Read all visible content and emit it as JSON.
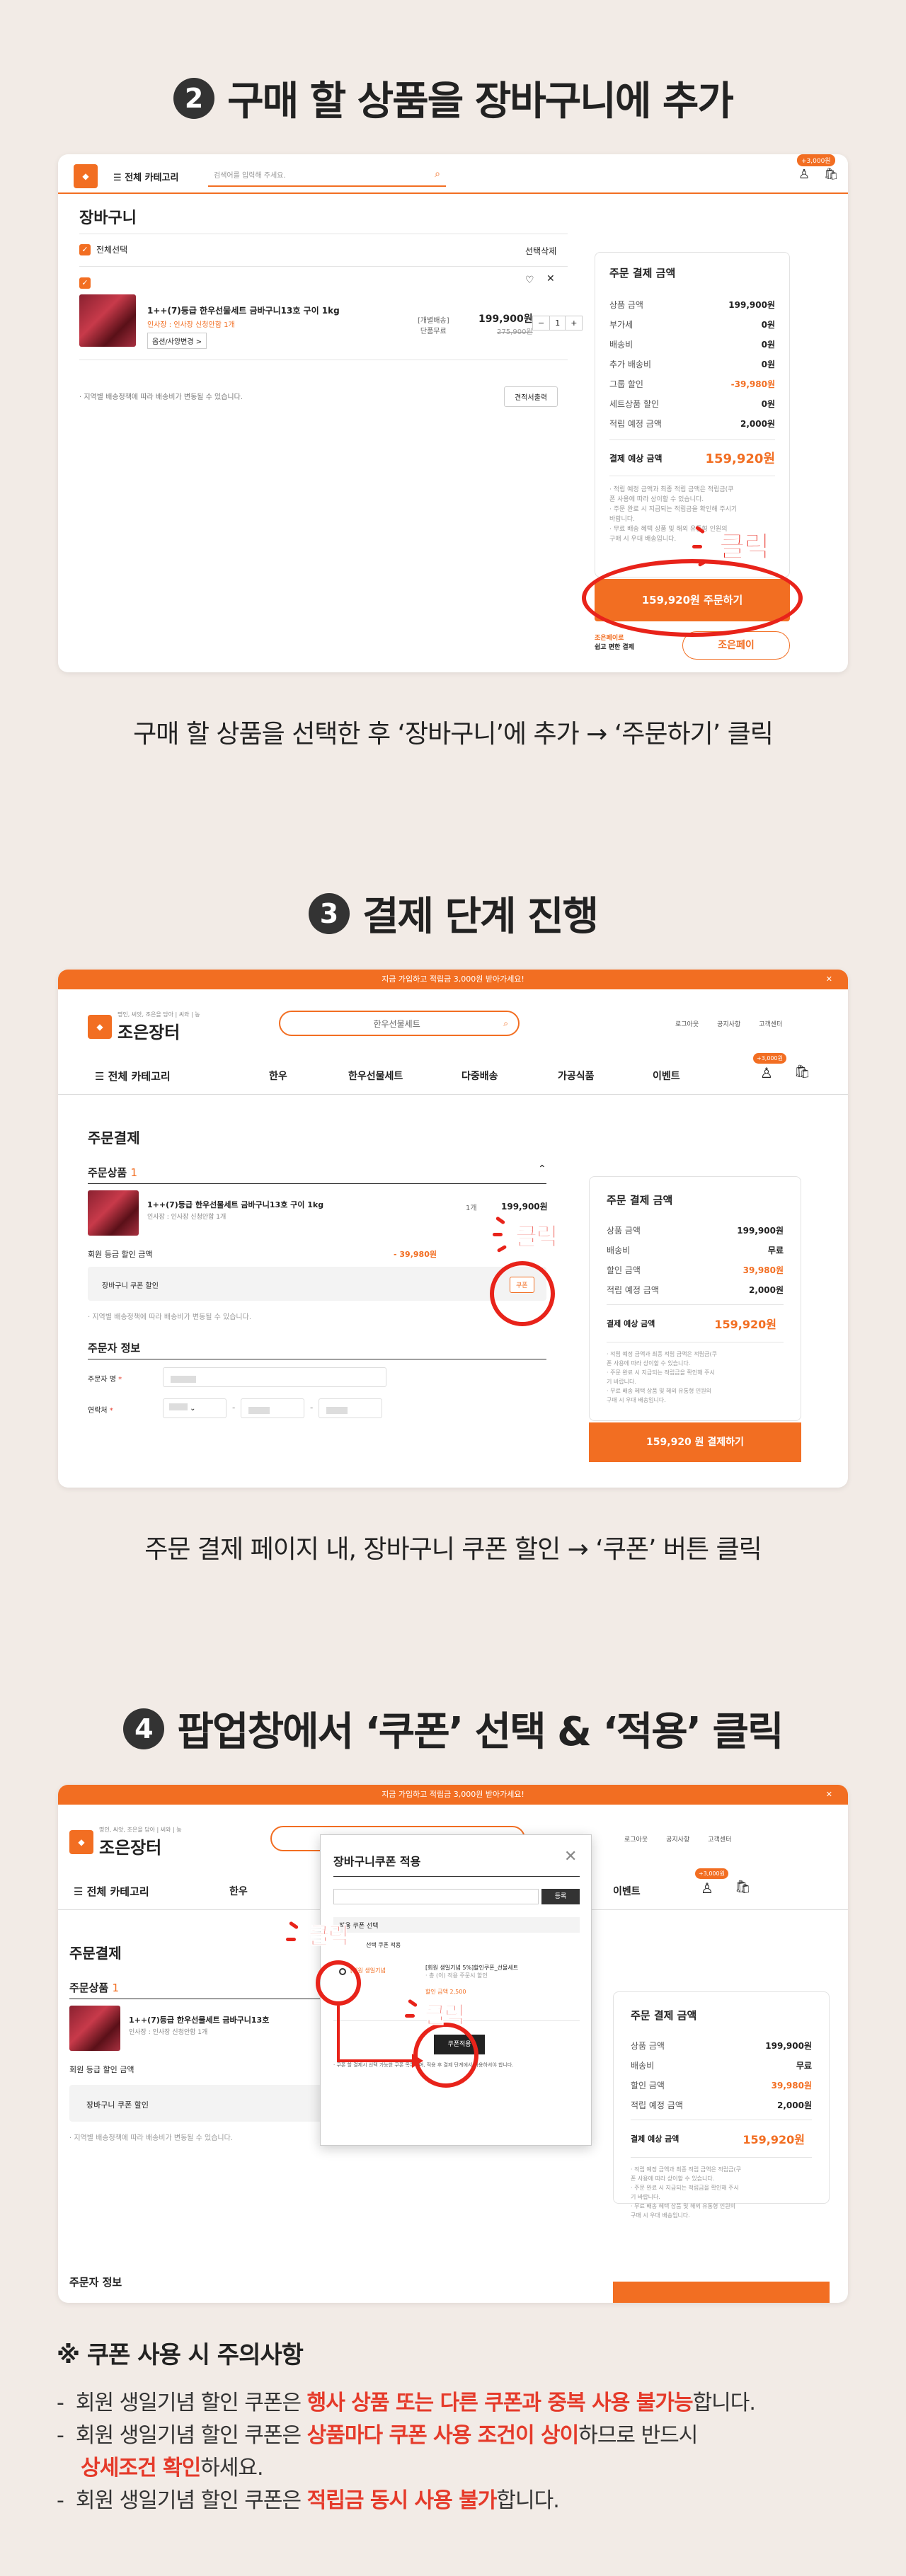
{
  "step2": {
    "num": "2",
    "title": "구매 할 상품을 장바구니에 추가",
    "caption": "구매 할 상품을 선택한 후 ‘장바구니’에 추가 → ‘주문하기’ 클릭"
  },
  "step3": {
    "num": "3",
    "title": "결제 단계 진행",
    "caption": "주문 결제 페이지 내, 장바구니 쿠폰 할인 → ‘쿠폰’ 버튼 클릭"
  },
  "step4": {
    "num": "4",
    "title": "팝업창에서 ‘쿠폰’ 선택 & ‘적용’ 클릭"
  },
  "click_label": "클릭",
  "s1": {
    "category": "전체 카테고리",
    "search_placeholder": "검색어를 입력해 주세요.",
    "badge": "+3,000원",
    "cart_title": "장바구니",
    "select_all": "전체선택",
    "delete_selected": "선택삭제",
    "product_name": "1++(7)등급 한우선물세트 금바구니13호 구이 1kg",
    "product_sub": "인사장 : 인사장 신청안함 1개",
    "option_btn": "옵션/사양변경 >",
    "ship_type": "[개별배송]",
    "ship_cost": "단품무료",
    "price": "199,900원",
    "orig_price": "275,900원",
    "qty": "1",
    "ship_note": "· 지역별 배송정책에 따라 배송비가 변동될 수 있습니다.",
    "estimate_btn": "견적서출력",
    "sum_title": "주문 결제 금액",
    "rows": [
      {
        "label": "상품 금액",
        "value": "199,900원"
      },
      {
        "label": "부가세",
        "value": "0원"
      },
      {
        "label": "배송비",
        "value": "0원"
      },
      {
        "label": "추가 배송비",
        "value": "0원"
      },
      {
        "label": "그룹 할인",
        "value": "-39,980원"
      },
      {
        "label": "세트상품 할인",
        "value": "0원"
      },
      {
        "label": "적립 예정 금액",
        "value": "2,000원"
      }
    ],
    "total_label": "결제 예상 금액",
    "total": "159,920원",
    "notes": [
      "· 적립 예정 금액과 최종 적립 금액은 적립금(쿠",
      "폰 사용에 따라 상이할 수 있습니다.",
      "· 주문 완료 시 지급되는 적립금을 확인해 주시기",
      "바랍니다.",
      "· 무료 배송 혜택 상품 및 해외 유통형 인원의",
      "구매 시 우대 배송입니다."
    ],
    "order_btn": "159,920원 주문하기",
    "pay_label1": "조은페이로",
    "pay_label2": "쉽고 편한 결제",
    "pay_btn": "조은페이"
  },
  "s2": {
    "topbar": "지금 가입하고 적립금 3,000원 받아가세요!",
    "logo_sub": "명인, 씨앗, 조은을 담아 | 씨와 | 농",
    "logo": "조은장터",
    "search": "한우선물세트",
    "links": [
      "로그아웃",
      "공지사항",
      "고객센터"
    ],
    "category": "전체 카테고리",
    "nav": [
      "한우",
      "한우선물세트",
      "다중배송",
      "가공식품",
      "이벤트"
    ],
    "badge": "+3,000원",
    "page_title": "주문결제",
    "items_label": "주문상품",
    "items_count": "1",
    "product_name": "1++(7)등급 한우선물세트 금바구니13호 구이 1kg",
    "product_sub": "인사장 : 인사장 신청안함 1개",
    "qty": "1개",
    "price": "199,900원",
    "grade_discount": "회원 등급 할인 금액",
    "grade_value": "- 39,980원",
    "coupon_label": "장바구니 쿠폰 할인",
    "coupon_btn": "쿠폰",
    "ship_note": "· 지역별 배송정책에 따라 배송비가 변동될 수 있습니다.",
    "orderer": "주문자 정보",
    "name_label": "주문자 명",
    "phone_label": "연락처",
    "sum_title": "주문 결제 금액",
    "rows": [
      {
        "label": "상품 금액",
        "value": "199,900원"
      },
      {
        "label": "배송비",
        "value": "무료"
      },
      {
        "label": "할인 금액",
        "value": "39,980원"
      },
      {
        "label": "적립 예정 금액",
        "value": "2,000원"
      }
    ],
    "total_label": "결제 예상 금액",
    "total": "159,920원",
    "notes": [
      "· 적립 예정 금액과 최종 적립 금액은 적립금(쿠",
      "폰 사용에 따라 상이할 수 있습니다.",
      "· 주문 완료 시 지급되는 적립금을 확인해 주시",
      "기 바랍니다.",
      "· 무료 배송 혜택 상품 및 해외 유통형 인원의",
      "구매 시 우대 배송입니다."
    ],
    "pay_btn": "159,920 원 결제하기"
  },
  "s3": {
    "popup_title": "장바구니쿠폰 적용",
    "popup_search_btn": "등록",
    "popup_section": "적용 쿠폰 선택",
    "popup_section2": "선택 쿠폰 적용",
    "coupon_name": "[회원 생일기념 5%]할인쿠폰_선물세트",
    "coupon_detail": "· 총 (이) 적용 주문시 할인",
    "coupon_value": "할인 금액 2,500",
    "apply_btn": "쿠폰적용",
    "popup_note": "· 쿠폰 할 결제시 선택 가능한 쿠폰 목록이며, 적용 후 결제 단계에서 사용하셔야 합니다."
  },
  "caution": {
    "title": "※ 쿠폰 사용 시 주의사항",
    "lines": [
      {
        "pre": "-  회원 생일기념 할인 쿠폰은 ",
        "hl": "행사 상품 또는 다른 쿠폰과 중복 사용 불가능",
        "post": "합니다."
      },
      {
        "pre": "-  회원 생일기념 할인 쿠폰은 ",
        "hl": "상품마다 쿠폰 사용 조건이 상이",
        "post": "하므로 반드시"
      },
      {
        "pre": "    ",
        "hl": "상세조건 확인",
        "post": "하세요."
      },
      {
        "pre": "-  회원 생일기념 할인 쿠폰은 ",
        "hl": "적립금 동시 사용 불가",
        "post": "합니다."
      }
    ]
  }
}
